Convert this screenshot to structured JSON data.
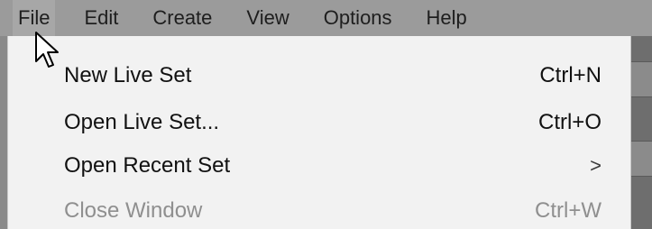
{
  "menubar": {
    "items": [
      {
        "label": "File"
      },
      {
        "label": "Edit"
      },
      {
        "label": "Create"
      },
      {
        "label": "View"
      },
      {
        "label": "Options"
      },
      {
        "label": "Help"
      }
    ]
  },
  "file_menu": {
    "items": [
      {
        "label": "New Live Set",
        "shortcut": "Ctrl+N",
        "enabled": true
      },
      {
        "label": "Open Live Set...",
        "shortcut": "Ctrl+O",
        "enabled": true
      },
      {
        "label": "Open Recent Set",
        "submenu_indicator": ">",
        "enabled": true
      },
      {
        "label": "Close Window",
        "shortcut": "Ctrl+W",
        "enabled": false
      }
    ]
  },
  "colors": {
    "menubar_bg": "#9b9b9b",
    "menu_bg": "#f2f2f2",
    "text": "#111111",
    "disabled_text": "#8f8f8f"
  },
  "icons": {
    "cursor": "arrow-cursor-icon"
  }
}
